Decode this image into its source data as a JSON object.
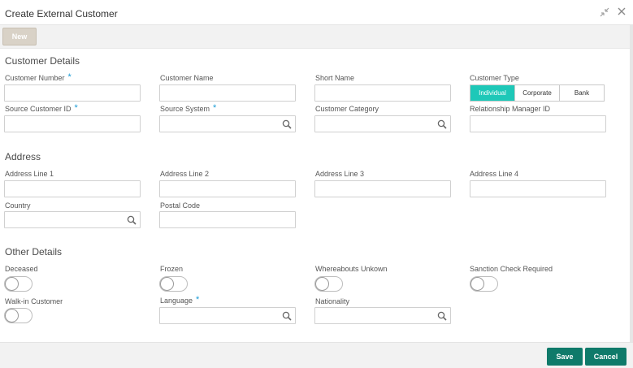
{
  "window": {
    "title": "Create External Customer"
  },
  "toolbar": {
    "new_label": "New"
  },
  "sections": {
    "customer_details": "Customer Details",
    "address": "Address",
    "other_details": "Other Details"
  },
  "fields": {
    "customer_number": {
      "label": "Customer Number",
      "value": ""
    },
    "customer_name": {
      "label": "Customer Name",
      "value": ""
    },
    "short_name": {
      "label": "Short Name",
      "value": ""
    },
    "customer_type": {
      "label": "Customer Type",
      "options": [
        "Individual",
        "Corporate",
        "Bank"
      ],
      "selected": "Individual"
    },
    "source_customer_id": {
      "label": "Source Customer ID",
      "value": ""
    },
    "source_system": {
      "label": "Source System",
      "value": ""
    },
    "customer_category": {
      "label": "Customer Category",
      "value": ""
    },
    "relationship_manager_id": {
      "label": "Relationship Manager ID",
      "value": ""
    },
    "address_line_1": {
      "label": "Address Line 1",
      "value": ""
    },
    "address_line_2": {
      "label": "Address Line 2",
      "value": ""
    },
    "address_line_3": {
      "label": "Address Line 3",
      "value": ""
    },
    "address_line_4": {
      "label": "Address Line 4",
      "value": ""
    },
    "country": {
      "label": "Country",
      "value": ""
    },
    "postal_code": {
      "label": "Postal Code",
      "value": ""
    },
    "deceased": {
      "label": "Deceased",
      "on": false
    },
    "frozen": {
      "label": "Frozen",
      "on": false
    },
    "whereabouts_unknown": {
      "label": "Whereabouts Unkown",
      "on": false
    },
    "sanction_check_required": {
      "label": "Sanction Check Required",
      "on": false
    },
    "walk_in_customer": {
      "label": "Walk-in Customer",
      "on": false
    },
    "language": {
      "label": "Language",
      "value": ""
    },
    "nationality": {
      "label": "Nationality",
      "value": ""
    }
  },
  "required_marker": "*",
  "footer": {
    "save_label": "Save",
    "cancel_label": "Cancel"
  },
  "colors": {
    "accent": "#1ec8b8",
    "primary_button": "#0f7a6a",
    "required": "#1a9bd6"
  }
}
